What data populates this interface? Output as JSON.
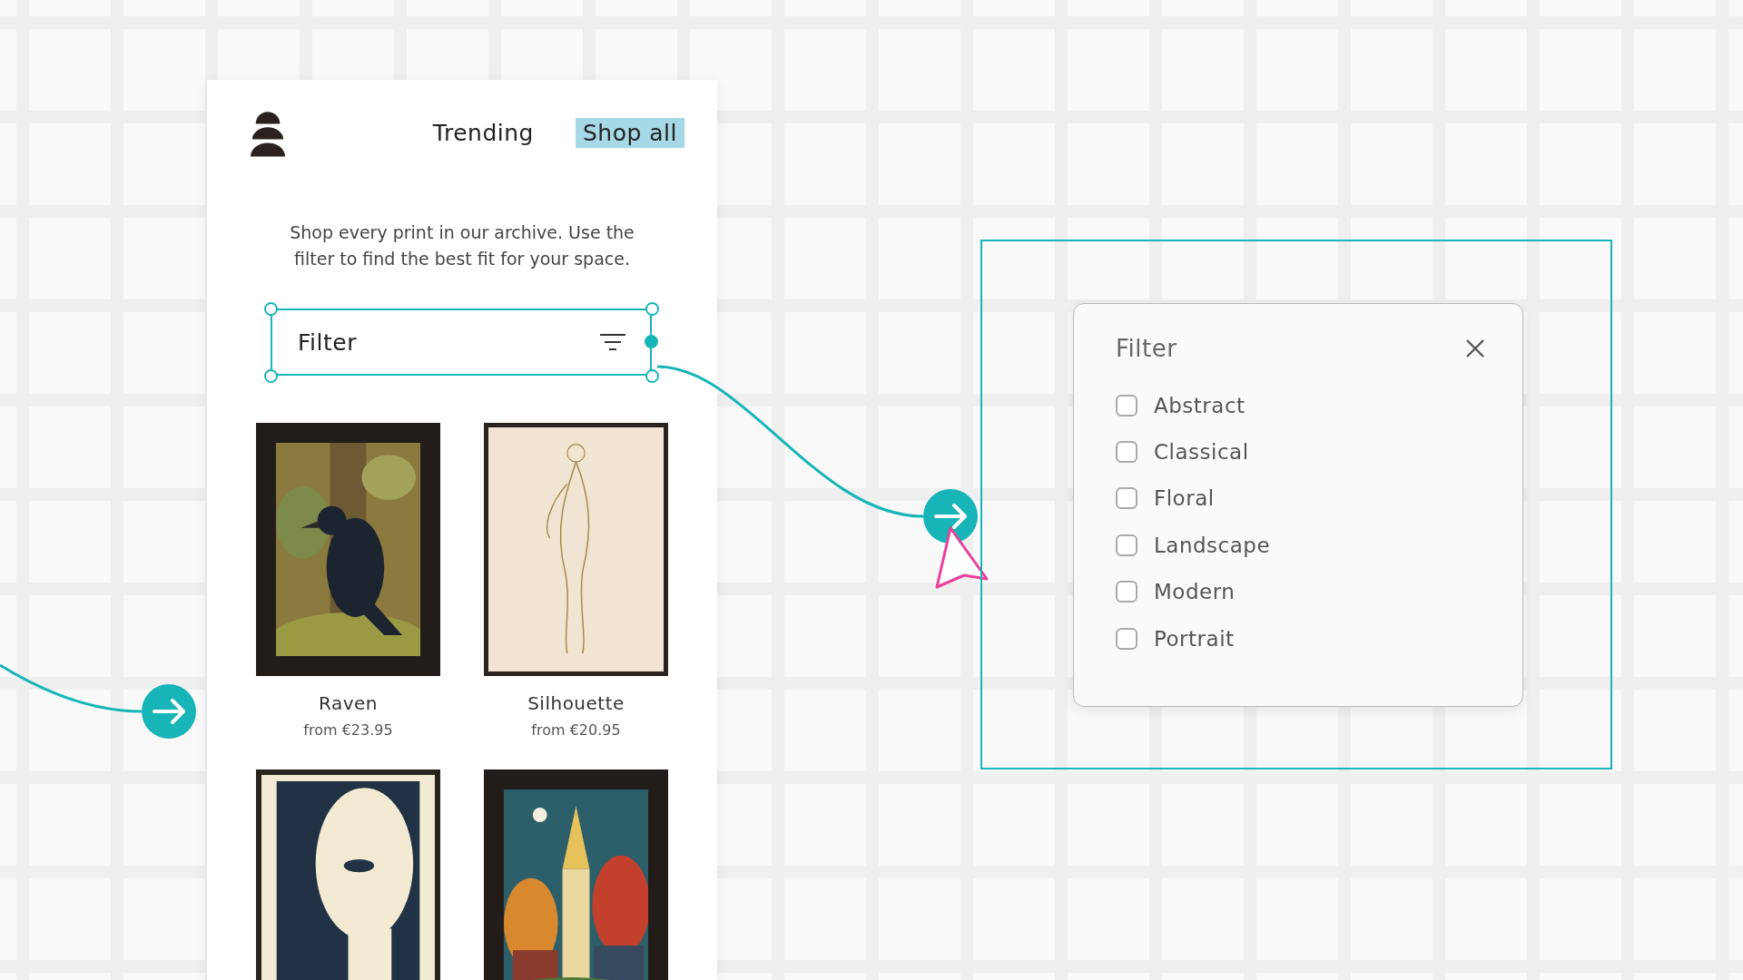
{
  "nav": {
    "items": [
      {
        "label": "Trending",
        "selected": false
      },
      {
        "label": "Shop all",
        "selected": true
      }
    ]
  },
  "intro": "Shop every print in our archive. Use the filter to find the best fit for your space.",
  "filter_button": {
    "label": "Filter",
    "selected": true
  },
  "products": [
    {
      "kind": "picture",
      "name": "Raven",
      "price": "from €23.95"
    },
    {
      "kind": "picture",
      "name": "Silhouette",
      "price": "from €20.95"
    },
    {
      "kind": "picture"
    },
    {
      "kind": "picture"
    }
  ],
  "filter_dialog": {
    "title": "Filter",
    "options": [
      {
        "label": "Abstract",
        "checked": false
      },
      {
        "label": "Classical",
        "checked": false
      },
      {
        "label": "Floral",
        "checked": false
      },
      {
        "label": "Landscape",
        "checked": false
      },
      {
        "label": "Modern",
        "checked": false
      },
      {
        "label": "Portrait",
        "checked": false
      }
    ]
  }
}
